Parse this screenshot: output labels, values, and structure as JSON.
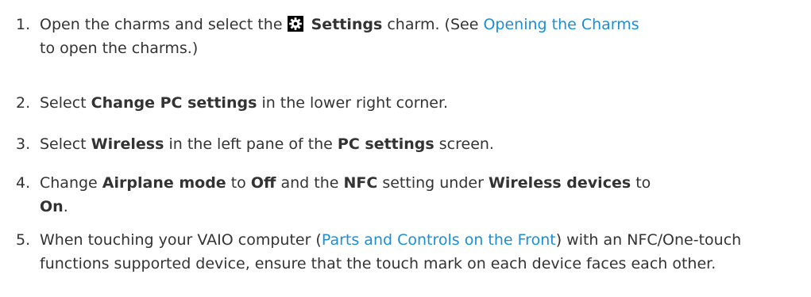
{
  "steps": [
    {
      "number": "1.",
      "t1": "Open the charms and select the",
      "bold1": "Settings",
      "t2": "charm. (See",
      "link": "Opening the Charms",
      "t3": "to open the charms.)",
      "icon": "settings-gear-icon"
    },
    {
      "number": "2.",
      "t1": "Select",
      "bold1": "Change PC settings",
      "t2": "in the lower right corner."
    },
    {
      "number": "3.",
      "t1": "Select",
      "bold1": "Wireless",
      "t2": "in the left pane of the",
      "bold2": "PC settings",
      "t3": "screen."
    },
    {
      "number": "4.",
      "t1": "Change",
      "bold1": "Airplane mode",
      "t2": "to",
      "bold2": "Off",
      "t3": "and the",
      "bold3": "NFC",
      "t4": "setting under",
      "bold4": "Wireless devices",
      "t5": "to",
      "bold5": "On",
      "t6": "."
    },
    {
      "number": "5.",
      "t1": "When touching your VAIO computer (",
      "link": "Parts and Controls on the Front",
      "t2": ") with an NFC/One-touch functions supported device, ensure that the touch mark on each device faces each other."
    }
  ],
  "colors": {
    "text": "#333333",
    "link": "#1a8fd6",
    "icon_bg": "#000000",
    "icon_fg": "#ffffff"
  }
}
